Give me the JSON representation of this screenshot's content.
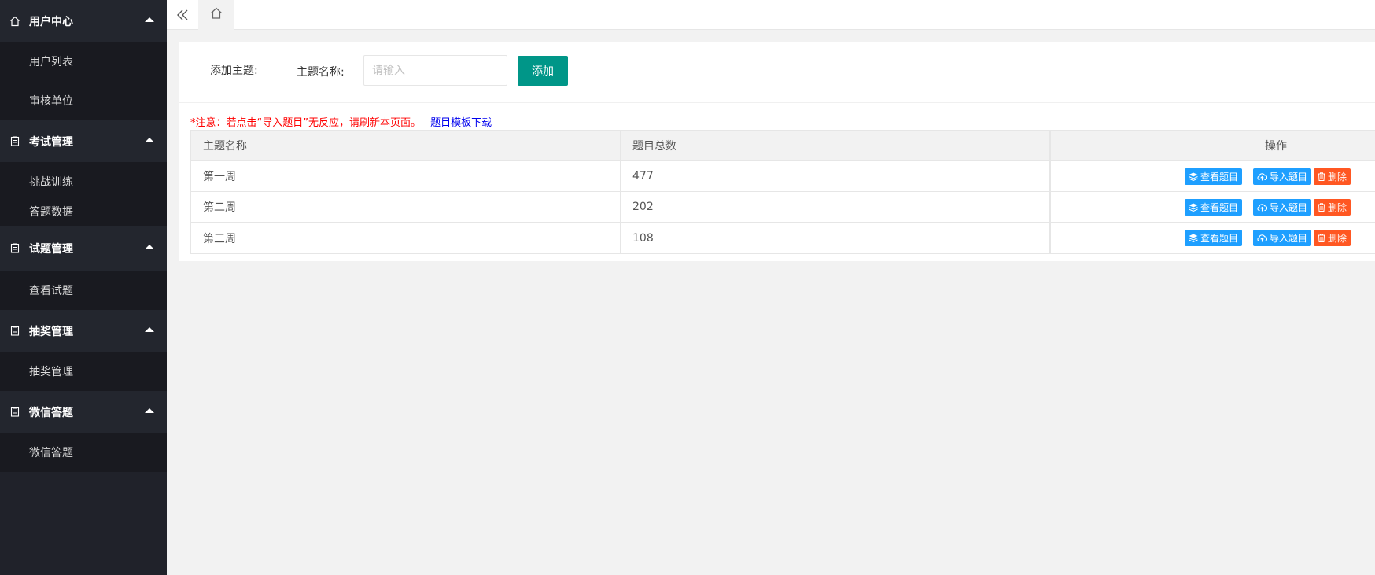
{
  "sidebar": {
    "groups": [
      {
        "title": "用户中心",
        "icon": "home-icon",
        "items": [
          "用户列表",
          "审核单位"
        ]
      },
      {
        "title": "考试管理",
        "icon": "clipboard-icon",
        "items": [
          "挑战训练",
          "答题数据"
        ]
      },
      {
        "title": "试题管理",
        "icon": "clipboard-icon",
        "items": [
          "查看试题"
        ]
      },
      {
        "title": "抽奖管理",
        "icon": "clipboard-icon",
        "items": [
          "抽奖管理"
        ]
      },
      {
        "title": "微信答题",
        "icon": "clipboard-icon",
        "items": [
          "微信答题"
        ]
      }
    ]
  },
  "topbar": {
    "collapse_icon": "double-chevron-left-icon",
    "home_icon": "home-icon"
  },
  "form": {
    "title": "添加主题:",
    "label": "主题名称:",
    "placeholder": "请输入",
    "value": "",
    "add_label": "添加"
  },
  "notice": {
    "warning": "*注意：若点击“导入题目”无反应，请刷新本页面。",
    "template_link": "题目模板下载"
  },
  "table": {
    "headers": [
      "主题名称",
      "题目总数",
      "操作"
    ],
    "rows": [
      {
        "name": "第一周",
        "count": "477"
      },
      {
        "name": "第二周",
        "count": "202"
      },
      {
        "name": "第三周",
        "count": "108"
      }
    ],
    "actions": {
      "view": "查看题目",
      "import": "导入题目",
      "delete": "删除"
    }
  },
  "colors": {
    "sidebar_bg": "#20222a",
    "primary": "#009688",
    "blue": "#1e9fff",
    "danger": "#ff5722",
    "warning_text": "#ff0000",
    "link_text": "#0000ee"
  }
}
